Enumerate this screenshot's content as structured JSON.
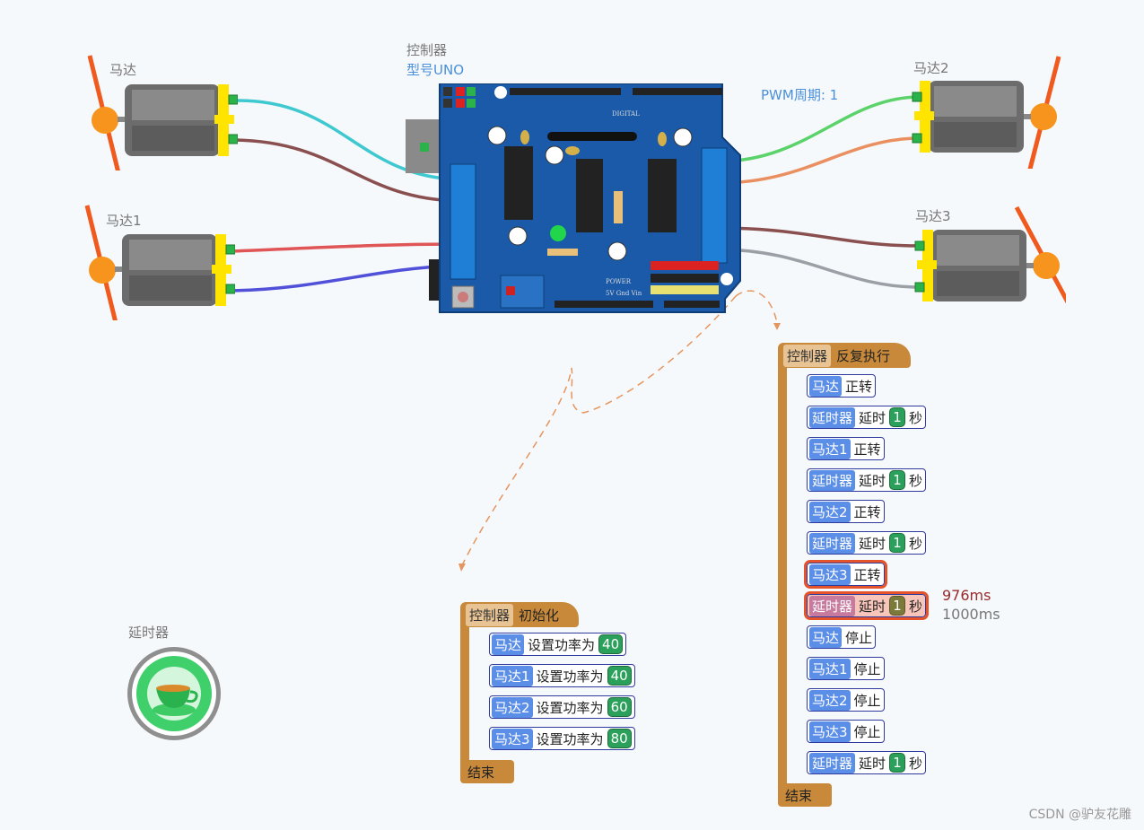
{
  "labels": {
    "motor0": "马达",
    "motor1": "马达1",
    "motor2": "马达2",
    "motor3": "马达3",
    "controller": "控制器",
    "model": "型号UNO",
    "pwm": "PWM周期: 1",
    "timer": "延时器"
  },
  "init_program": {
    "hat_tag": "控制器",
    "hat_text": "初始化",
    "blocks": [
      {
        "tag": "马达",
        "text": "设置功率为",
        "value": "40"
      },
      {
        "tag": "马达1",
        "text": "设置功率为",
        "value": "40"
      },
      {
        "tag": "马达2",
        "text": "设置功率为",
        "value": "60"
      },
      {
        "tag": "马达3",
        "text": "设置功率为",
        "value": "80"
      }
    ],
    "end": "结束"
  },
  "loop_program": {
    "hat_tag": "控制器",
    "hat_text": "反复执行",
    "blocks": [
      {
        "tag": "马达",
        "text": "正转"
      },
      {
        "tag": "延时器",
        "text": "延时",
        "value": "1",
        "unit": "秒"
      },
      {
        "tag": "马达1",
        "text": "正转"
      },
      {
        "tag": "延时器",
        "text": "延时",
        "value": "1",
        "unit": "秒"
      },
      {
        "tag": "马达2",
        "text": "正转"
      },
      {
        "tag": "延时器",
        "text": "延时",
        "value": "1",
        "unit": "秒"
      },
      {
        "tag": "马达3",
        "text": "正转"
      },
      {
        "tag": "延时器",
        "text": "延时",
        "value": "1",
        "unit": "秒"
      },
      {
        "tag": "马达",
        "text": "停止"
      },
      {
        "tag": "马达1",
        "text": "停止"
      },
      {
        "tag": "马达2",
        "text": "停止"
      },
      {
        "tag": "马达3",
        "text": "停止"
      },
      {
        "tag": "延时器",
        "text": "延时",
        "value": "1",
        "unit": "秒"
      }
    ],
    "end": "结束"
  },
  "timing": {
    "elapsed": "976ms",
    "total": "1000ms"
  },
  "colors": {
    "highlight": "#e5532b",
    "wire_cyan": "#3ec8cf",
    "wire_green": "#5bd36a",
    "wire_orange": "#ea9060",
    "wire_brown": "#8a4f4f",
    "wire_red": "#e05555",
    "wire_blue": "#5050d8",
    "wire_gray": "#9aa0a6"
  },
  "board_pins": {
    "digital_label": "DIGITAL",
    "power_label": "POWER",
    "power_pins": "5V  Gnd  Vin"
  },
  "watermark": "CSDN @驴友花雕"
}
